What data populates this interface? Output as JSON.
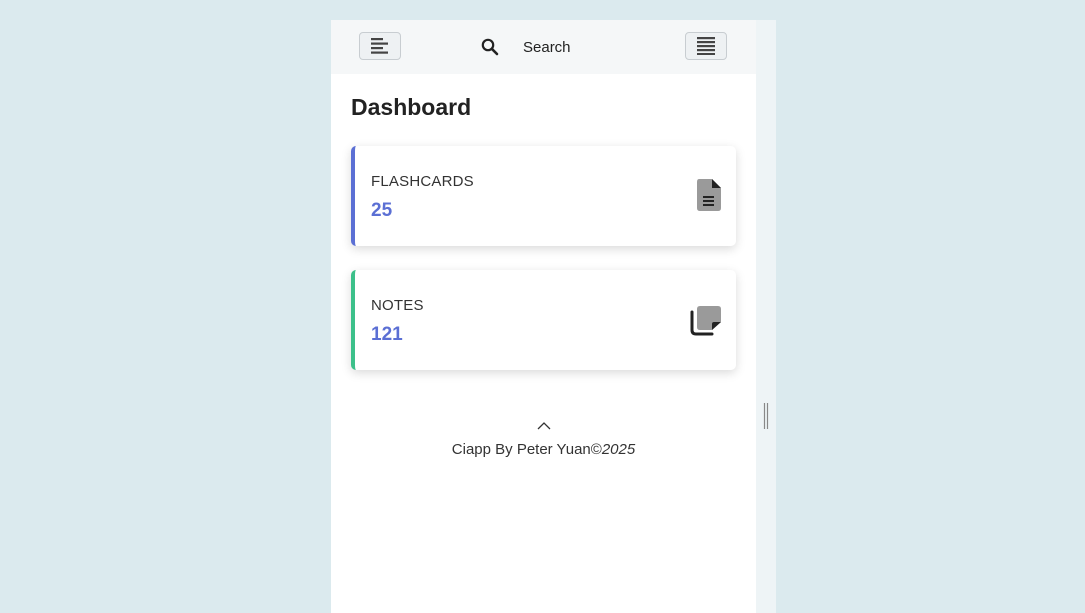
{
  "header": {
    "search_label": "Search",
    "left_toggle_icon": "align-left-icon",
    "right_toggle_icon": "menu-icon",
    "search_icon": "search-icon"
  },
  "page_title": "Dashboard",
  "cards": [
    {
      "label": "FLASHCARDS",
      "value": "25",
      "icon": "file-document-icon",
      "accent": "#5b6fd4"
    },
    {
      "label": "NOTES",
      "value": "121",
      "icon": "sticky-note-icon",
      "accent": "#3cc08a"
    }
  ],
  "footer": {
    "text": "Ciapp By Peter Yuan©",
    "year": "2025",
    "scroll_icon": "chevron-up-icon"
  },
  "colors": {
    "background": "#dbeaee",
    "value_text": "#5b6fd4"
  }
}
